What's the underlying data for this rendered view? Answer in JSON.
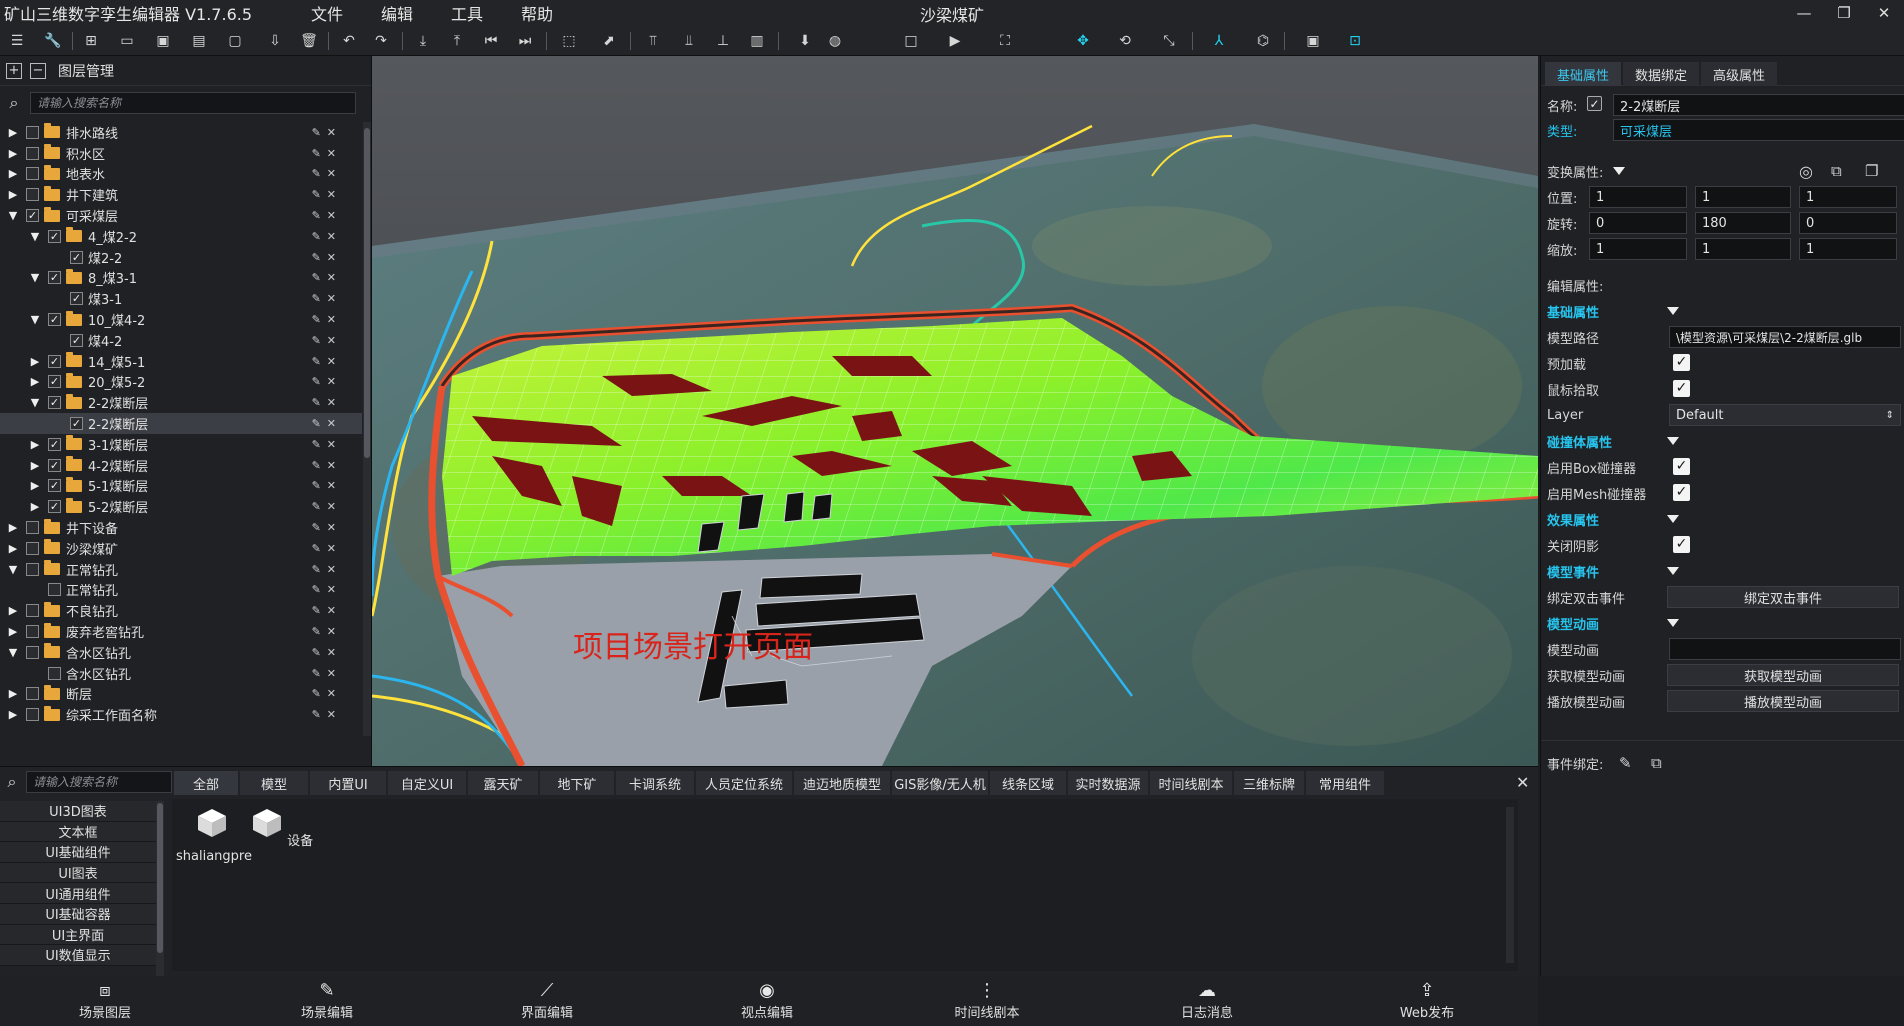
{
  "titlebar": {
    "app_title": "矿山三维数字孪生编辑器 V1.7.6.5",
    "menu": [
      "文件",
      "编辑",
      "工具",
      "帮助"
    ],
    "scene_title": "沙梁煤矿"
  },
  "layer_panel": {
    "title": "图层管理",
    "search_placeholder": "请输入搜索名称",
    "items": [
      {
        "label": "排水路线",
        "depth": 0,
        "expand": "closed",
        "folder": true,
        "checked": false
      },
      {
        "label": "积水区",
        "depth": 0,
        "expand": "closed",
        "folder": true,
        "checked": false
      },
      {
        "label": "地表水",
        "depth": 0,
        "expand": "closed",
        "folder": true,
        "checked": false
      },
      {
        "label": "井下建筑",
        "depth": 0,
        "expand": "closed",
        "folder": true,
        "checked": false
      },
      {
        "label": "可采煤层",
        "depth": 0,
        "expand": "open",
        "folder": true,
        "checked": true
      },
      {
        "label": "4_煤2-2",
        "depth": 1,
        "expand": "open",
        "folder": true,
        "checked": true
      },
      {
        "label": "煤2-2",
        "depth": 2,
        "expand": "none",
        "folder": false,
        "checked": true
      },
      {
        "label": "8_煤3-1",
        "depth": 1,
        "expand": "open",
        "folder": true,
        "checked": true
      },
      {
        "label": "煤3-1",
        "depth": 2,
        "expand": "none",
        "folder": false,
        "checked": true
      },
      {
        "label": "10_煤4-2",
        "depth": 1,
        "expand": "open",
        "folder": true,
        "checked": true
      },
      {
        "label": "煤4-2",
        "depth": 2,
        "expand": "none",
        "folder": false,
        "checked": true
      },
      {
        "label": "14_煤5-1",
        "depth": 1,
        "expand": "closed",
        "folder": true,
        "checked": true
      },
      {
        "label": "20_煤5-2",
        "depth": 1,
        "expand": "closed",
        "folder": true,
        "checked": true
      },
      {
        "label": "2-2煤断层",
        "depth": 1,
        "expand": "open",
        "folder": true,
        "checked": true
      },
      {
        "label": "2-2煤断层",
        "depth": 2,
        "expand": "none",
        "folder": false,
        "checked": true,
        "selected": true
      },
      {
        "label": "3-1煤断层",
        "depth": 1,
        "expand": "closed",
        "folder": true,
        "checked": true
      },
      {
        "label": "4-2煤断层",
        "depth": 1,
        "expand": "closed",
        "folder": true,
        "checked": true
      },
      {
        "label": "5-1煤断层",
        "depth": 1,
        "expand": "closed",
        "folder": true,
        "checked": true
      },
      {
        "label": "5-2煤断层",
        "depth": 1,
        "expand": "closed",
        "folder": true,
        "checked": true
      },
      {
        "label": "井下设备",
        "depth": 0,
        "expand": "closed",
        "folder": true,
        "checked": false
      },
      {
        "label": "沙梁煤矿",
        "depth": 0,
        "expand": "closed",
        "folder": true,
        "checked": false
      },
      {
        "label": "正常钻孔",
        "depth": 0,
        "expand": "open",
        "folder": true,
        "checked": false
      },
      {
        "label": "正常钻孔",
        "depth": 1,
        "expand": "none",
        "folder": false,
        "checked": false
      },
      {
        "label": "不良钻孔",
        "depth": 0,
        "expand": "closed",
        "folder": true,
        "checked": false
      },
      {
        "label": "废弃老窖钻孔",
        "depth": 0,
        "expand": "closed",
        "folder": true,
        "checked": false
      },
      {
        "label": "含水区钻孔",
        "depth": 0,
        "expand": "open",
        "folder": true,
        "checked": false
      },
      {
        "label": "含水区钻孔",
        "depth": 1,
        "expand": "none",
        "folder": false,
        "checked": false
      },
      {
        "label": "断层",
        "depth": 0,
        "expand": "closed",
        "folder": true,
        "checked": false
      },
      {
        "label": "综采工作面名称",
        "depth": 0,
        "expand": "closed",
        "folder": true,
        "checked": false
      }
    ]
  },
  "viewport": {
    "overlay_text": "项目场景打开页面"
  },
  "properties": {
    "tabs": [
      "基础属性",
      "数据绑定",
      "高级属性"
    ],
    "name_label": "名称:",
    "name_value": "2-2煤断层",
    "type_label": "类型:",
    "type_value": "可采煤层",
    "transform_label": "变换属性:",
    "position_label": "位置:",
    "position": [
      "1",
      "1",
      "1"
    ],
    "rotation_label": "旋转:",
    "rotation": [
      "0",
      "180",
      "0"
    ],
    "scale_label": "缩放:",
    "scale": [
      "1",
      "1",
      "1"
    ],
    "edit_label": "编辑属性:",
    "basic_section": "基础属性",
    "model_path_label": "模型路径",
    "model_path_value": "\\模型资源\\可采煤层\\2-2煤断层.glb",
    "preload_label": "预加载",
    "mouse_pick_label": "鼠标拾取",
    "layer_label": "Layer",
    "layer_value": "Default",
    "collider_section": "碰撞体属性",
    "box_collider_label": "启用Box碰撞器",
    "mesh_collider_label": "启用Mesh碰撞器",
    "effect_section": "效果属性",
    "shadow_label": "关闭阴影",
    "event_section": "模型事件",
    "dblclick_label": "绑定双击事件",
    "dblclick_btn": "绑定双击事件",
    "anim_section": "模型动画",
    "anim_label": "模型动画",
    "anim_value": "",
    "get_anim_label": "获取模型动画",
    "get_anim_btn": "获取模型动画",
    "play_anim_label": "播放模型动画",
    "play_anim_btn": "播放模型动画",
    "event_bind_label": "事件绑定:"
  },
  "library": {
    "search_placeholder": "请输入搜索名称",
    "tabs": [
      "全部",
      "模型",
      "内置UI",
      "自定义UI",
      "露天矿",
      "地下矿",
      "卡调系统",
      "人员定位系统",
      "迪迈地质模型",
      "GIS影像/无人机",
      "线条区域",
      "实时数据源",
      "时间线剧本",
      "三维标牌",
      "常用组件"
    ],
    "categories": [
      "UI3D图表",
      "文本框",
      "UI基础组件",
      "UI图表",
      "UI通用组件",
      "UI基础容器",
      "UI主界面",
      "UI数值显示"
    ],
    "assets": [
      "shaliangpre",
      "设备"
    ]
  },
  "bottom_nav": [
    "场景图层",
    "场景编辑",
    "界面编辑",
    "视点编辑",
    "时间线剧本",
    "日志消息",
    "Web发布"
  ],
  "colors": {
    "accent": "#27c4ee",
    "folder": "#e8a73a",
    "overlay_text": "#d9241b"
  }
}
